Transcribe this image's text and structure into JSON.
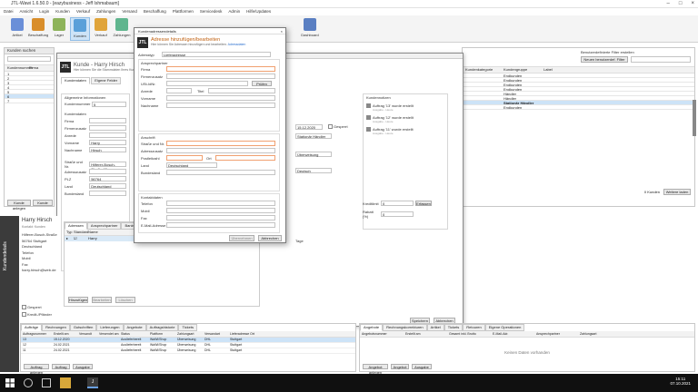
{
  "window": {
    "title": "JTL-Wawi 1.6.50.0 - [eazybusiness - Jeff Ishmabaum]"
  },
  "menu": [
    "Datei",
    "Ansicht",
    "Login",
    "Kunden",
    "Verkauf",
    "Zahlungen",
    "Versand",
    "Beschaffung",
    "Plattformen",
    "Servicedesk",
    "Admin",
    "Hilfe/Updates"
  ],
  "ribbon": [
    {
      "label": "Artikel",
      "color": "#6a8fd8"
    },
    {
      "label": "Beschaffung",
      "color": "#d98e2b"
    },
    {
      "label": "Lager",
      "color": "#8db35a"
    },
    {
      "label": "Kunden",
      "color": "#5aa0d9"
    },
    {
      "label": "Verkauf",
      "color": "#e0a43a"
    },
    {
      "label": "Zahlungen",
      "color": "#5fb58e"
    },
    {
      "label": "Dashboard",
      "color": "#5a7fc2"
    }
  ],
  "left": {
    "search_label": "Kunden suchen",
    "col_kundennummer": "Kundennummer",
    "col_firma": "Firma",
    "rows": [
      "1",
      "2",
      "3",
      "4",
      "5",
      "6",
      "7"
    ],
    "add_btn": "Kunde anlegen",
    "kunde_btn": "Kunde"
  },
  "right": {
    "filter_label": "Benutzerdefinierte Filter erstellen",
    "filter_btn": "Neuen benutzerdef. Filter",
    "col_kundengruppe": "Kundengruppe",
    "col_label": "Label",
    "col_kundenkategorie": "Kundenkategorie",
    "groups": [
      "Endkunden",
      "Endkunden",
      "Endkunden",
      "Endkunden",
      "Händler",
      "Händler",
      "Stationär Händler",
      "Endkunden"
    ],
    "count": "0 Kunden",
    "count_btn": "Weitere laden"
  },
  "kunde": {
    "title": "Kunde - Harry Hirsch",
    "subtitle": "Hier können Sie die Stammdaten Ihres Kunden bearbeiten.",
    "tab1": "Kundendaten",
    "tab2": "Eigene Felder",
    "section_allg": "Allgemeine Informationen",
    "kundennummer_label": "Kundennummer",
    "kundennummer": "5",
    "section_kd": "Kundendaten",
    "firma": "Firma",
    "firmenzusatz": "Firmenzusatz",
    "anrede": "Anrede",
    "titel": "Titel",
    "vorname": "Vorname",
    "vorname_val": "Harry",
    "nachname": "Nachname",
    "nachname_val": "Hirsch",
    "strasse": "Straße und Nr.",
    "strasse_val": "Hilferer-Bosch-Straße 48",
    "adresszusatz": "Adresszusatz",
    "plz": "PLZ",
    "plz_val": "56764",
    "ort": "Ort",
    "ausgabe": "Ausgabe",
    "land": "Land",
    "land_val": "Deutschland",
    "bundesland": "Bundesland",
    "right_date": "15.12.2020",
    "right_gesperrt": "Gesperrt",
    "right_kat": "Stationär Händler",
    "right_zahl": "Überweisung",
    "right_sprache": "Deutsch",
    "section_notizen": "Kundennotizen",
    "note1": "Auftrag '13' wurde erstellt",
    "note1_sub": "Ausgabe - Heute",
    "note2": "Auftrag '12' wurde erstellt",
    "note2_sub": "Ausgabe - Heute",
    "note3": "Auftrag '11' wurde erstellt",
    "note3_sub": "Ausgabe - Heute",
    "tage_label": "Tage",
    "kreditlimit": "Kreditlimit",
    "rabatt": "Rabatt (%)",
    "zero": "0",
    "erfassen": "Erfassen",
    "speichern": "Speichern",
    "abbrechen": "Abbrechen"
  },
  "contact": {
    "header": "Kundendetails",
    "name": "Harry Hirsch",
    "sub": "Kontakt: Kunden",
    "lines": [
      "Hilferer-Bosch-Straße",
      "56764 Stuttgart",
      "Deutschland",
      "Telefon",
      "Mobil",
      "Fax",
      "harry.hirsch@web.de"
    ],
    "check1": "Gesperrt",
    "check2": "Kredit-/Pfänder",
    "tabs": [
      "Adressen",
      "Ansprechpartner",
      "Bankverbindungen"
    ],
    "col_typ": "Typ",
    "col_standard": "Standard",
    "col_name": "Name",
    "row_name": "Harry",
    "btn_hinzufuegen": "Hinzufügen",
    "btn_bearbeiten": "Bearbeiten",
    "btn_loeschen": "Löschen"
  },
  "dialog": {
    "title": "Kundenadressendetails",
    "heading": "Adresse hinzufügen/bearbeiten",
    "sub": "Hier können Sie Adressen hinzufügen und bearbeiten.",
    "sub_link": "Adressdaten",
    "adresstyp_label": "Adresstyp",
    "adresstyp_val": "Lieferadresse",
    "group_ansprech": "Ansprechpartner",
    "firma": "Firma",
    "firmenzusatz": "Firmenzusatz",
    "ustid": "USt-IdNr.",
    "pruefen": "Prüfen",
    "anrede": "Anrede",
    "titel": "Titel",
    "vorname": "Vorname",
    "nachname": "Nachname",
    "group_anschrift": "Anschrift",
    "strasse": "Straße und Nr.",
    "adresszusatz": "Adresszusatz",
    "postleitzahl": "Postleitzahl",
    "ort": "Ort",
    "land": "Land",
    "land_val": "Deutschland",
    "bundesland": "Bundesland",
    "group_kontakt": "Kontaktdaten",
    "telefon": "Telefon",
    "mobil": "Mobil",
    "fax": "Fax",
    "email": "E-Mail-Adresse",
    "uebernehmen": "Übernehmen",
    "abbrechen": "Abbrechen"
  },
  "bottom_left": {
    "tabs": [
      "Aufträge",
      "Rechnungen",
      "Gutschriften",
      "Lieferungen",
      "Angebote",
      "Auftragshistorie",
      "Tickets"
    ],
    "cols": [
      "Auftragsnummer",
      "Erstellt am",
      "Versandt",
      "Versendet am",
      "Status",
      "Plattform",
      "Zahlungsart",
      "Versandart",
      "Lieferadresse Ort"
    ],
    "rows": [
      [
        "13",
        "15.12.2020",
        "",
        "",
        "Auslieferbereit",
        "WaWi/Shop",
        "Überweisung",
        "DHL",
        "Stuttgart"
      ],
      [
        "12",
        "24.02.2021",
        "",
        "",
        "Auslieferbereit",
        "WaWi/Shop",
        "Überweisung",
        "DHL",
        "Stuttgart"
      ],
      [
        "11",
        "24.02.2021",
        "",
        "",
        "Auslieferbereit",
        "WaWi/Shop",
        "Überweisung",
        "DHL",
        "Stuttgart"
      ]
    ],
    "btn1": "Auftrag anlegen",
    "btn2": "Auftrag",
    "btn3": "Ausgabe"
  },
  "bottom_right": {
    "tabs": [
      "Angebote",
      "Rechnungskorrekturen",
      "Artikel",
      "Tickets",
      "Retouren",
      "Eigene Operationen"
    ],
    "cols": [
      "Angebotsnummer",
      "Erstellt am",
      "Gesamt inkl. Brutto",
      "E-Mail-Adr.",
      "Ansprechpartner",
      "Zahlungsart"
    ],
    "empty": "Keinen Daten vorhanden",
    "btn1": "Angebot anlegen",
    "btn2": "Angebot",
    "btn3": "Ausgabe"
  },
  "sidebar_label": "Kundendetails",
  "taskbar": {
    "time": "15:11",
    "date": "07.10.2021"
  }
}
